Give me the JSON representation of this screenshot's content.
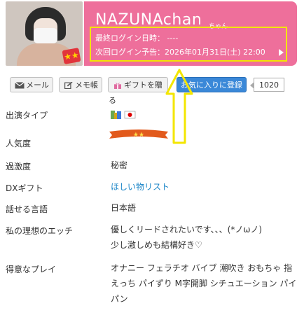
{
  "profile": {
    "name": "NAZUNAchan",
    "name_suffix": "ちゃん",
    "last_login": "最終ログイン日時： ----",
    "next_login": "次回ログイン予告：2026年01月31日(土) 22:00"
  },
  "actions": {
    "mail": "メール",
    "memo": "メモ帳",
    "gift": "ギフトを贈る",
    "favorite": "お気に入りに登録",
    "favorite_count": "1020"
  },
  "details": [
    {
      "label": "出演タイプ",
      "value": ""
    },
    {
      "label": "人気度",
      "value": ""
    },
    {
      "label": "過激度",
      "value": "秘密"
    },
    {
      "label": "DXギフト",
      "value": "ほしい物リスト"
    },
    {
      "label": "話せる言語",
      "value": "日本語"
    },
    {
      "label": "私の理想のエッチ",
      "value": "優しくリードされたいです、、、(*ノωノ)\n少し激しめも結構好き♡"
    },
    {
      "label": "得意なプレイ",
      "value": "オナニー フェラチオ バイブ 潮吹き おもちゃ 指えっち パイずり M字開脚 シチュエーション パイパン"
    }
  ],
  "icons": {
    "photo_badge": "★★",
    "popularity": "★★"
  },
  "colors": {
    "header_pink": "#ee6f9b",
    "highlight_yellow": "#f3e600",
    "fav_blue": "#3a88d8",
    "link_blue": "#1c86c8"
  }
}
